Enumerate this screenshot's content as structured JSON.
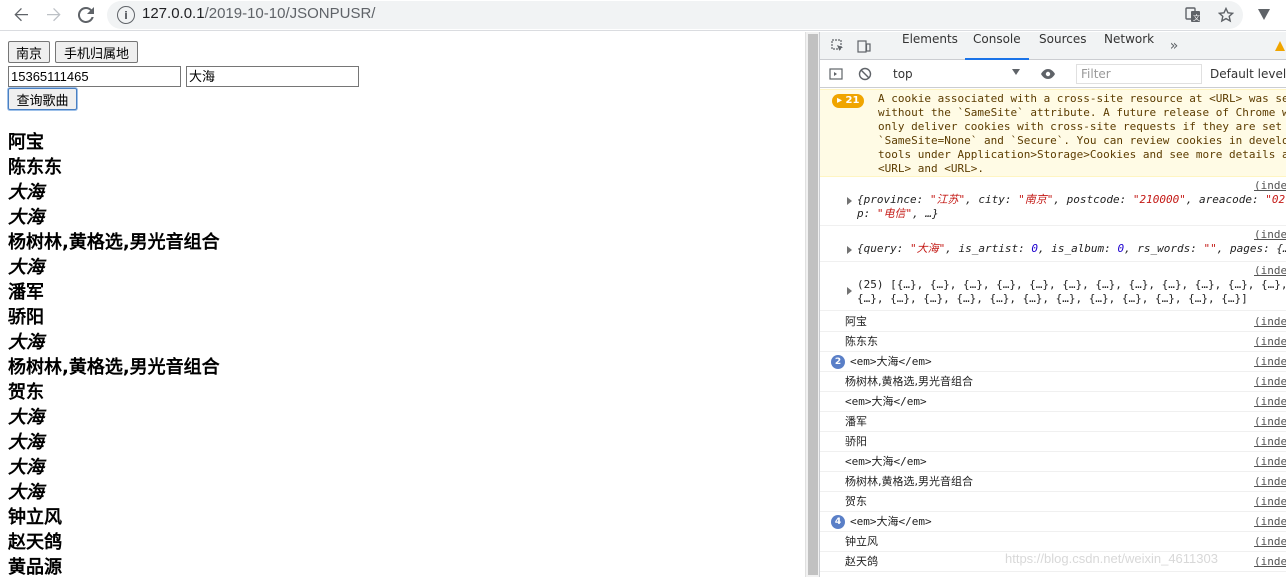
{
  "browser": {
    "url_host": "127.0.0.1",
    "url_path": "/2019-10-10/JSONPUSR/"
  },
  "page": {
    "btn_nanjing": "南京",
    "btn_phone_location": "手机归属地",
    "phone_input_value": "15365111465",
    "song_input_value": "大海",
    "btn_query": "查询歌曲",
    "songs": [
      {
        "text": "阿宝",
        "em": false
      },
      {
        "text": "陈东东",
        "em": false
      },
      {
        "text": "大海",
        "em": true
      },
      {
        "text": "大海",
        "em": true
      },
      {
        "text": "杨树林,黄格选,男光音组合",
        "em": false
      },
      {
        "text": "大海",
        "em": true
      },
      {
        "text": "潘军",
        "em": false
      },
      {
        "text": "骄阳",
        "em": false
      },
      {
        "text": "大海",
        "em": true
      },
      {
        "text": "杨树林,黄格选,男光音组合",
        "em": false
      },
      {
        "text": "贺东",
        "em": false
      },
      {
        "text": "大海",
        "em": true
      },
      {
        "text": "大海",
        "em": true
      },
      {
        "text": "大海",
        "em": true
      },
      {
        "text": "大海",
        "em": true
      },
      {
        "text": "钟立风",
        "em": false
      },
      {
        "text": "赵天鸽",
        "em": false
      },
      {
        "text": "黄品源",
        "em": false
      }
    ]
  },
  "devtools": {
    "tabs": [
      "Elements",
      "Console",
      "Sources",
      "Network"
    ],
    "active_tab": "Console",
    "context": "top",
    "filter_placeholder": "Filter",
    "levels_label": "Default levels",
    "warning_count": "21",
    "warning_text": "A cookie associated with a cross-site resource at <URL> was se\nwithout the `SameSite` attribute. A future release of Chrome w\nonly deliver cookies with cross-site requests if they are set\n`SameSite=None` and `Secure`. You can review cookies in develo\ntools under Application>Storage>Cookies and see more details a\n<URL> and <URL>.",
    "source_link": "(inde",
    "objects": [
      {
        "line1_pre": "{province: ",
        "line1_s1": "\"江苏\"",
        "line1_mid1": ", city: ",
        "line1_s2": "\"南京\"",
        "line1_mid2": ", postcode: ",
        "line1_s3": "\"210000\"",
        "line1_mid3": ", areacode: ",
        "line1_s4": "\"02",
        "line2_pre": "p: ",
        "line2_s1": "\"电信\"",
        "line2_post": ", …}"
      },
      {
        "line1_pre": "{query: ",
        "line1_s1": "\"大海\"",
        "line1_mid1": ", is_artist: ",
        "line1_n1": "0",
        "line1_mid2": ", is_album: ",
        "line1_n2": "0",
        "line1_mid3": ", rs_words: ",
        "line1_s2": "\"\"",
        "line1_post": ", pages: {…"
      },
      {
        "line1": "(25) [{…}, {…}, {…}, {…}, {…}, {…}, {…}, {…}, {…}, {…}, {…}, {…},",
        "line2": "{…}, {…}, {…}, {…}, {…}, {…}, {…}, {…}, {…}, {…}, {…}, {…}]"
      }
    ],
    "logs": [
      {
        "text": "阿宝",
        "mono": false,
        "count": ""
      },
      {
        "text": "陈东东",
        "mono": false,
        "count": ""
      },
      {
        "text": "<em>大海</em>",
        "mono": true,
        "count": "2"
      },
      {
        "text": "杨树林,黄格选,男光音组合",
        "mono": false,
        "count": ""
      },
      {
        "text": "<em>大海</em>",
        "mono": true,
        "count": ""
      },
      {
        "text": "潘军",
        "mono": false,
        "count": ""
      },
      {
        "text": "骄阳",
        "mono": false,
        "count": ""
      },
      {
        "text": "<em>大海</em>",
        "mono": true,
        "count": ""
      },
      {
        "text": "杨树林,黄格选,男光音组合",
        "mono": false,
        "count": ""
      },
      {
        "text": "贺东",
        "mono": false,
        "count": ""
      },
      {
        "text": "<em>大海</em>",
        "mono": true,
        "count": "4"
      },
      {
        "text": "钟立风",
        "mono": false,
        "count": ""
      },
      {
        "text": "赵天鸽",
        "mono": false,
        "count": ""
      }
    ]
  },
  "watermark": "https://blog.csdn.net/weixin_4611303"
}
